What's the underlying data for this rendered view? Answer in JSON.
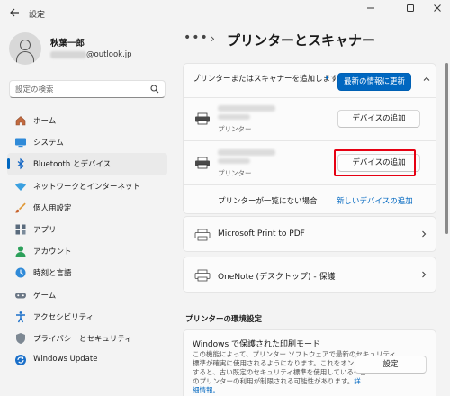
{
  "window": {
    "title": "設定",
    "controls": [
      "minimize-icon",
      "maximize-icon",
      "close-icon"
    ]
  },
  "user": {
    "name": "秋葉一郎",
    "email_suffix": "@outlook.jp"
  },
  "search": {
    "placeholder": "設定の検索"
  },
  "sidebar": {
    "items": [
      {
        "label": "ホーム",
        "icon": "home-icon",
        "active": false
      },
      {
        "label": "システム",
        "icon": "system-icon",
        "active": false
      },
      {
        "label": "Bluetooth とデバイス",
        "icon": "bluetooth-icon",
        "active": true
      },
      {
        "label": "ネットワークとインターネット",
        "icon": "network-icon",
        "active": false
      },
      {
        "label": "個人用設定",
        "icon": "brush-icon",
        "active": false
      },
      {
        "label": "アプリ",
        "icon": "apps-icon",
        "active": false
      },
      {
        "label": "アカウント",
        "icon": "account-icon",
        "active": false
      },
      {
        "label": "時刻と言語",
        "icon": "time-language-icon",
        "active": false
      },
      {
        "label": "ゲーム",
        "icon": "gaming-icon",
        "active": false
      },
      {
        "label": "アクセシビリティ",
        "icon": "accessibility-icon",
        "active": false
      },
      {
        "label": "プライバシーとセキュリティ",
        "icon": "shield-icon",
        "active": false
      },
      {
        "label": "Windows Update",
        "icon": "update-icon",
        "active": false
      }
    ]
  },
  "breadcrumb": {
    "more": "•••",
    "title": "プリンターとスキャナー"
  },
  "add_section": {
    "label": "プリンターまたはスキャナーを追加します",
    "refresh_button": "最新の情報に更新",
    "devices": [
      {
        "type": "プリンター",
        "add_button": "デバイスの追加",
        "highlighted": false
      },
      {
        "type": "プリンター",
        "add_button": "デバイスの追加",
        "highlighted": true
      }
    ],
    "not_listed_label": "プリンターが一覧にない場合",
    "manual_link": "新しいデバイスの追加"
  },
  "printers": [
    {
      "name": "Microsoft Print to PDF"
    },
    {
      "name": "OneNote (デスクトップ) - 保護"
    }
  ],
  "preferences": {
    "heading": "プリンターの環境設定",
    "protected_mode": {
      "title": "Windows で保護された印刷モード",
      "description_line1": "この機能によって、プリンター ソフトウェアで最新のセキュリティ",
      "description_line2": "標準が確実に使用されるようになります。これをオンに",
      "description_line3": "すると、古い既定のセキュリティ標準を使用している一部",
      "description_line4": "のプリンターの利用が制限される可能性があります。",
      "details_link": "詳",
      "details_link_cont": "細情報。",
      "settings_button": "設定"
    }
  },
  "colors": {
    "accent": "#0067c0",
    "highlight": "#e60012"
  }
}
